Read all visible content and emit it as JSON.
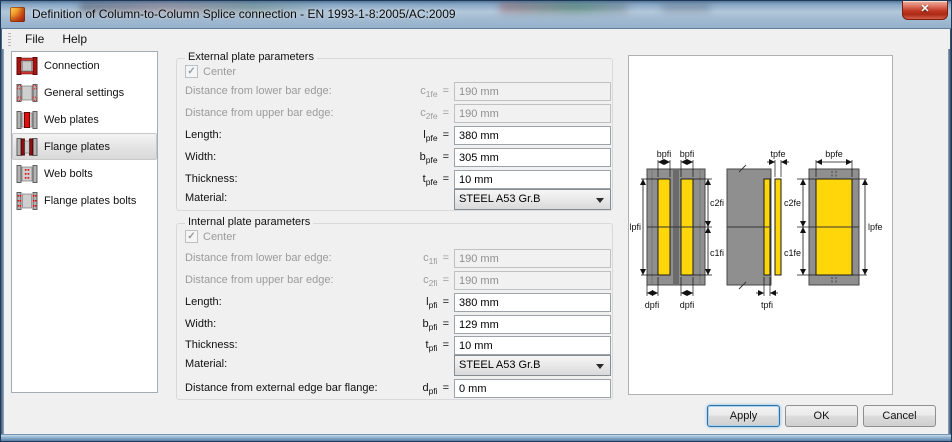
{
  "window": {
    "title": "Definition of Column-to-Column Splice connection - EN 1993-1-8:2005/AC:2009",
    "close_glyph": "✕"
  },
  "menu": {
    "file": "File",
    "help": "Help"
  },
  "sidebar": {
    "selected": "Flange plates",
    "items": [
      {
        "label": "Connection"
      },
      {
        "label": "General settings"
      },
      {
        "label": "Web plates"
      },
      {
        "label": "Flange plates"
      },
      {
        "label": "Web bolts"
      },
      {
        "label": "Flange plates bolts"
      }
    ]
  },
  "form": {
    "equals": "=",
    "check_glyph": "✓",
    "external": {
      "title": "External plate parameters",
      "center_label": "Center",
      "center_checked": true,
      "rows": [
        {
          "label": "Distance from lower bar edge:",
          "sym": "c",
          "sub": "1fe",
          "value": "190 mm",
          "disabled": true
        },
        {
          "label": "Distance from upper bar edge:",
          "sym": "c",
          "sub": "2fe",
          "value": "190 mm",
          "disabled": true
        },
        {
          "label": "Length:",
          "sym": "l",
          "sub": "pfe",
          "value": "380 mm",
          "disabled": false
        },
        {
          "label": "Width:",
          "sym": "b",
          "sub": "pfe",
          "value": "305 mm",
          "disabled": false
        },
        {
          "label": "Thickness:",
          "sym": "t",
          "sub": "pfe",
          "value": "10 mm",
          "disabled": false
        }
      ],
      "material_label": "Material:",
      "material_value": "STEEL A53 Gr.B"
    },
    "internal": {
      "title": "Internal plate parameters",
      "center_label": "Center",
      "center_checked": true,
      "rows": [
        {
          "label": "Distance from lower bar edge:",
          "sym": "c",
          "sub": "1fi",
          "value": "190 mm",
          "disabled": true
        },
        {
          "label": "Distance from upper bar edge:",
          "sym": "c",
          "sub": "2fi",
          "value": "190 mm",
          "disabled": true
        },
        {
          "label": "Length:",
          "sym": "l",
          "sub": "pfi",
          "value": "380 mm",
          "disabled": false
        },
        {
          "label": "Width:",
          "sym": "b",
          "sub": "pfi",
          "value": "129 mm",
          "disabled": false
        },
        {
          "label": "Thickness:",
          "sym": "t",
          "sub": "pfi",
          "value": "10 mm",
          "disabled": false
        }
      ],
      "material_label": "Material:",
      "material_value": "STEEL A53 Gr.B",
      "extra_row": {
        "label": "Distance from external edge bar flange:",
        "sym": "d",
        "sub": "pfi",
        "value": "0 mm",
        "disabled": false
      }
    }
  },
  "diagram": {
    "labels": {
      "bpfi": "bpfi",
      "tpfe": "tpfe",
      "bpfe": "bpfe",
      "lpfi": "lpfi",
      "c2fi": "c2fi",
      "c1fi": "c1fi",
      "c2fe": "c2fe",
      "c1fe": "c1fe",
      "lpfe": "lpfe",
      "dpfi": "dpfi",
      "tpfi": "tpfi"
    },
    "colors": {
      "plate": "#ffd60a",
      "column": "#8f8f8f"
    }
  },
  "buttons": {
    "apply": "Apply",
    "ok": "OK",
    "cancel": "Cancel"
  },
  "theme": {
    "focus_blue": "#2f73a8",
    "close_red": "#c03722",
    "titlebar_blue": "#a3bbd2",
    "dialog_bg": "#f0f0f0"
  }
}
